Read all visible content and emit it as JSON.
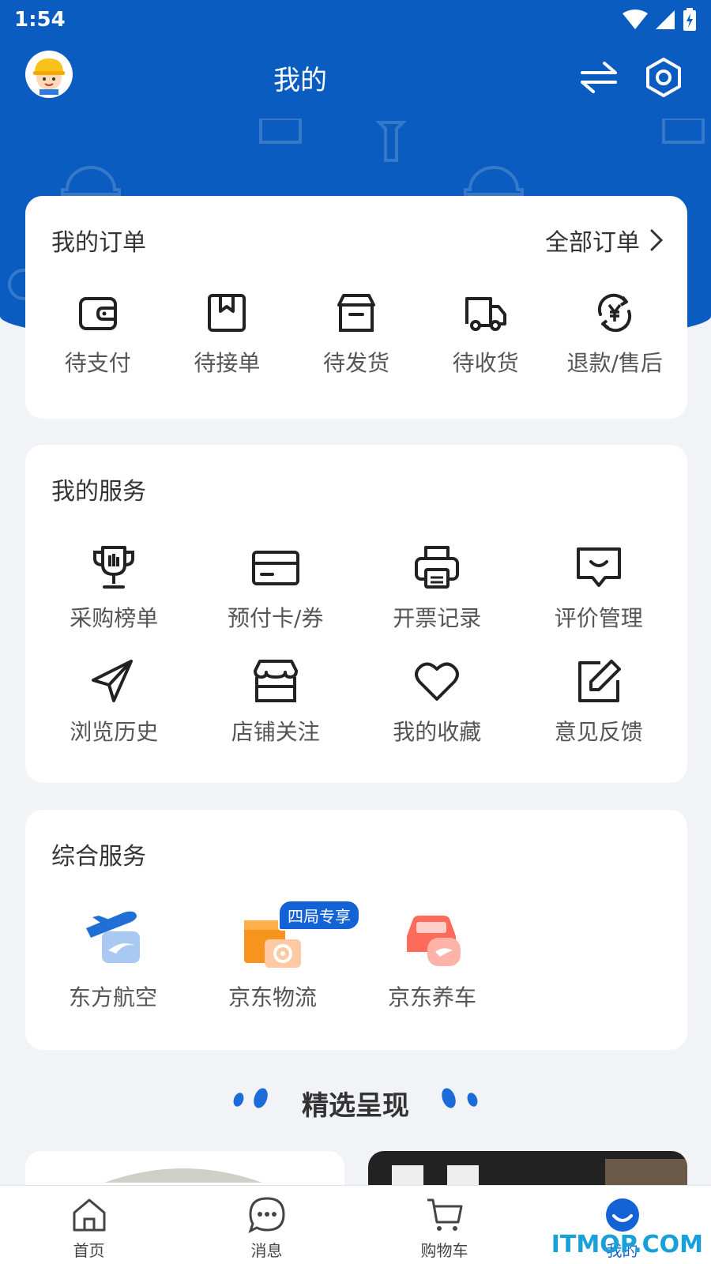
{
  "status_bar": {
    "time": "1:54",
    "wifi_icon": "wifi-icon",
    "signal_icon": "signal-icon",
    "battery_icon": "battery-charging-icon"
  },
  "header": {
    "title": "我的",
    "avatar_icon": "worker-avatar-icon",
    "switch_icon": "switch-arrows-icon",
    "settings_icon": "gear-icon"
  },
  "orders": {
    "title": "我的订单",
    "all_link": "全部订单",
    "items": [
      {
        "label": "待支付",
        "icon": "wallet-icon"
      },
      {
        "label": "待接单",
        "icon": "bookmark-box-icon"
      },
      {
        "label": "待发货",
        "icon": "package-icon"
      },
      {
        "label": "待收货",
        "icon": "truck-icon"
      },
      {
        "label": "退款/售后",
        "icon": "refund-yen-icon"
      }
    ]
  },
  "services": {
    "title": "我的服务",
    "items": [
      {
        "label": "采购榜单",
        "icon": "trophy-icon"
      },
      {
        "label": "预付卡/券",
        "icon": "card-icon"
      },
      {
        "label": "开票记录",
        "icon": "printer-icon"
      },
      {
        "label": "评价管理",
        "icon": "message-smile-icon"
      },
      {
        "label": "浏览历史",
        "icon": "paper-plane-icon"
      },
      {
        "label": "店铺关注",
        "icon": "store-icon"
      },
      {
        "label": "我的收藏",
        "icon": "heart-icon"
      },
      {
        "label": "意见反馈",
        "icon": "edit-icon"
      }
    ]
  },
  "general": {
    "title": "综合服务",
    "items": [
      {
        "label": "东方航空",
        "icon": "airline-icon"
      },
      {
        "label": "京东物流",
        "icon": "logistics-icon",
        "badge": "四局专享"
      },
      {
        "label": "京东养车",
        "icon": "car-care-icon"
      }
    ]
  },
  "featured": {
    "title": "精选呈现"
  },
  "tabbar": [
    {
      "label": "首页",
      "icon": "home-icon"
    },
    {
      "label": "消息",
      "icon": "chat-icon"
    },
    {
      "label": "购物车",
      "icon": "cart-icon"
    },
    {
      "label": "我的",
      "icon": "profile-smile-icon",
      "active": true
    }
  ],
  "watermark": "ITMOP.COM",
  "colors": {
    "brand_blue": "#0a5cc0",
    "accent_blue": "#1463d6",
    "orange": "#f7941d",
    "coral": "#ff6b5b",
    "page_bg": "#f2f3f7"
  }
}
